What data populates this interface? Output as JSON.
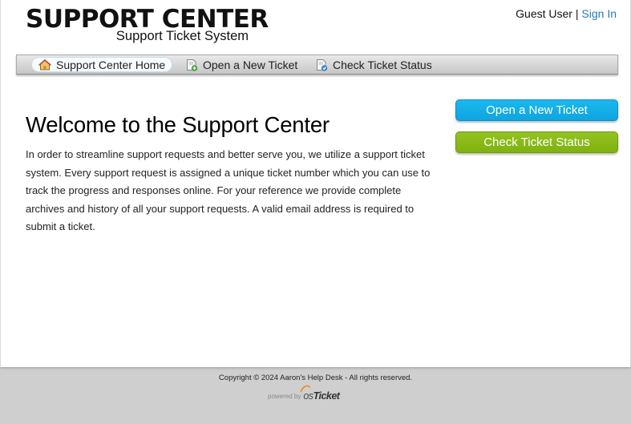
{
  "header": {
    "title": "SUPPORT CENTER",
    "subtitle": "Support Ticket System",
    "user_label": "Guest User",
    "separator": "|",
    "signin_label": "Sign In"
  },
  "nav": {
    "items": [
      {
        "label": "Support Center Home",
        "icon": "home-icon",
        "active": true
      },
      {
        "label": "Open a New Ticket",
        "icon": "new-ticket-icon",
        "active": false
      },
      {
        "label": "Check Ticket Status",
        "icon": "ticket-status-icon",
        "active": false
      }
    ]
  },
  "main": {
    "heading": "Welcome to the Support Center",
    "body": "In order to streamline support requests and better serve you, we utilize a support ticket system. Every support request is assigned a unique ticket number which you can use to track the progress and responses online. For your reference we provide complete archives and history of all your support requests. A valid email address is required to submit a ticket."
  },
  "sidebar": {
    "open_ticket_label": "Open a New Ticket",
    "check_status_label": "Check Ticket Status"
  },
  "footer": {
    "copyright": "Copyright © 2024 Aaron's Help Desk - All rights reserved.",
    "powered_by": "powered by",
    "brand_os": "os",
    "brand_ticket": "Ticket"
  },
  "colors": {
    "link": "#1f7bc0",
    "open_button": "#1cb7ee",
    "status_button": "#8cbf1a",
    "page_background": "#cfcfcf"
  }
}
